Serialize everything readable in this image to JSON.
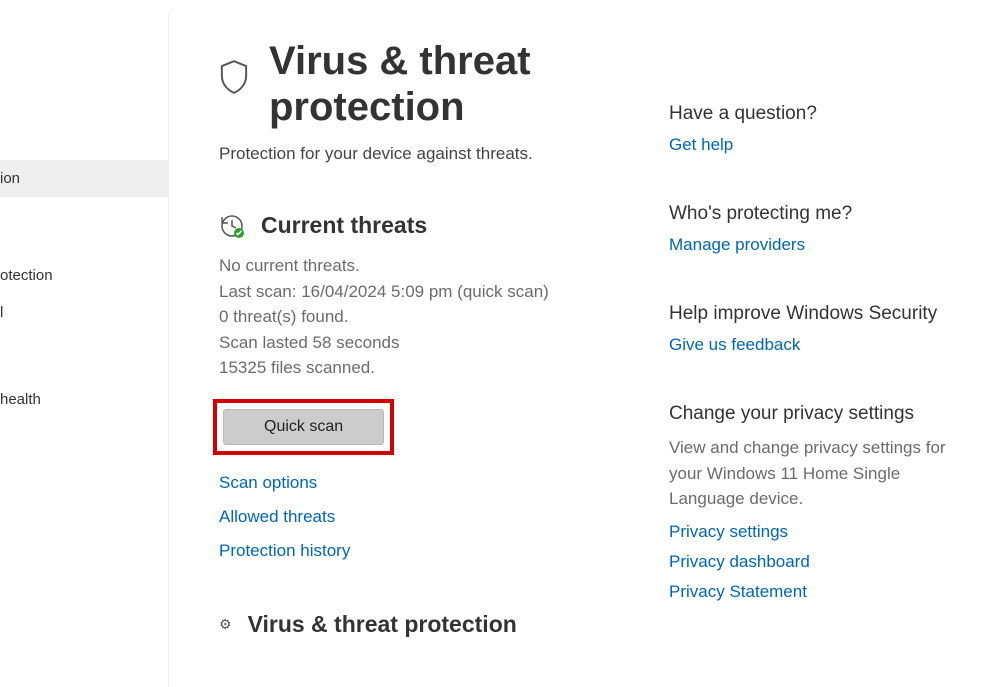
{
  "sidebar": {
    "items": [
      {
        "label": "ion"
      },
      {
        "label": "otection"
      },
      {
        "label": "l"
      },
      {
        "label": " health"
      }
    ]
  },
  "header": {
    "title": "Virus & threat protection",
    "subtitle": "Protection for your device against threats."
  },
  "currentThreats": {
    "title": "Current threats",
    "status": "No current threats.",
    "lastScan": "Last scan: 16/04/2024 5:09 pm (quick scan)",
    "found": "0 threat(s) found.",
    "duration": "Scan lasted 58 seconds",
    "filesScanned": "15325 files scanned.",
    "quickScan": "Quick scan",
    "links": {
      "scanOptions": "Scan options",
      "allowedThreats": "Allowed threats",
      "protectionHistory": "Protection history"
    }
  },
  "nextSection": {
    "title": "Virus & threat protection"
  },
  "aside": {
    "question": {
      "title": "Have a question?",
      "link": "Get help"
    },
    "protecting": {
      "title": "Who's protecting me?",
      "link": "Manage providers"
    },
    "improve": {
      "title": "Help improve Windows Security",
      "link": "Give us feedback"
    },
    "privacy": {
      "title": "Change your privacy settings",
      "text": "View and change privacy settings for your Windows 11 Home Single Language device.",
      "links": {
        "settings": "Privacy settings",
        "dashboard": "Privacy dashboard",
        "statement": "Privacy Statement"
      }
    }
  }
}
